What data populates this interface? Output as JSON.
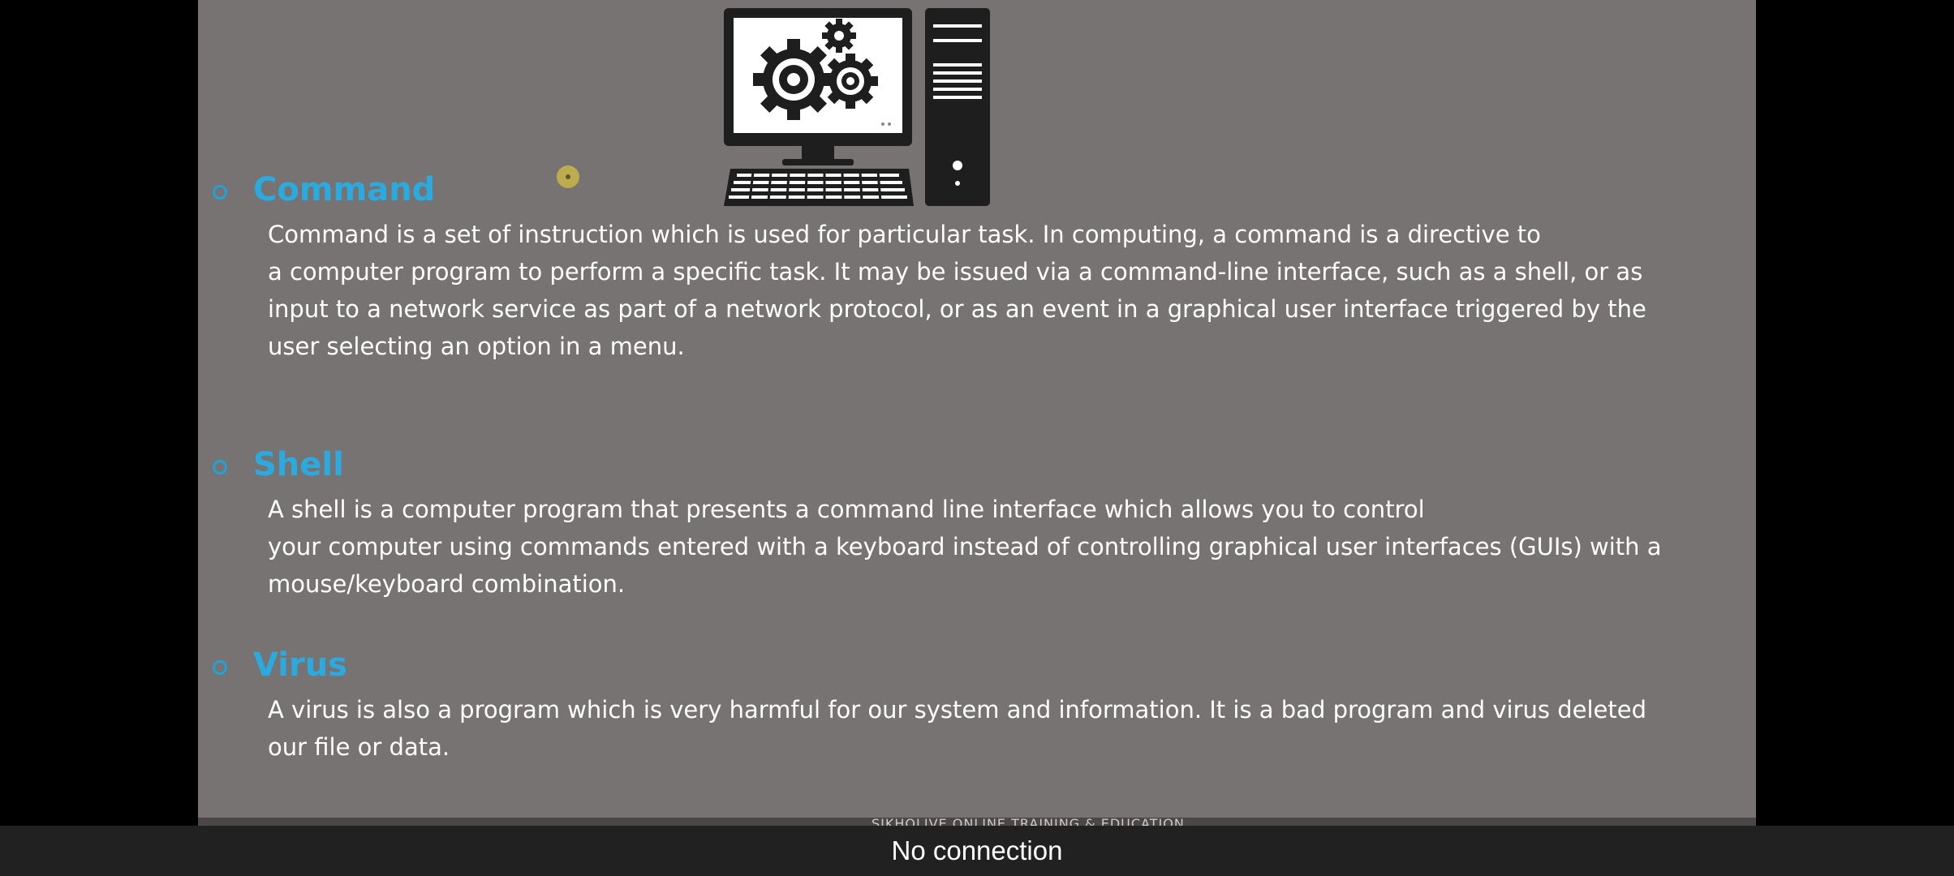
{
  "slide": {
    "sections": [
      {
        "heading": "Command",
        "lines": [
          "Command is a set of instruction which is used for particular task. In computing, a command is a directive to",
          "a computer program to perform a specific task. It may be issued via a command-line interface, such as a shell, or as",
          "input to a network service as part of a network protocol, or as an event in a graphical user interface triggered by the",
          "user selecting an option in a menu."
        ]
      },
      {
        "heading": "Shell",
        "lines": [
          "A shell is a computer program that presents a command line interface which allows you to control",
          "your computer using commands entered with a keyboard instead of controlling graphical user interfaces (GUIs) with a",
          "mouse/keyboard combination."
        ]
      },
      {
        "heading": "Virus",
        "lines": [
          "A virus is also a program which is very harmful for our system and information. It is a bad program and  virus deleted",
          "our file  or data."
        ]
      }
    ],
    "footer_text": "SIKHOLIVE ONLINE TRAINING & EDUCATION",
    "illustration_icon": "computer-gears-icon",
    "colors": {
      "background": "#777372",
      "heading": "#29abe2",
      "body_text": "#ffffff"
    }
  },
  "status": {
    "message": "No connection"
  }
}
